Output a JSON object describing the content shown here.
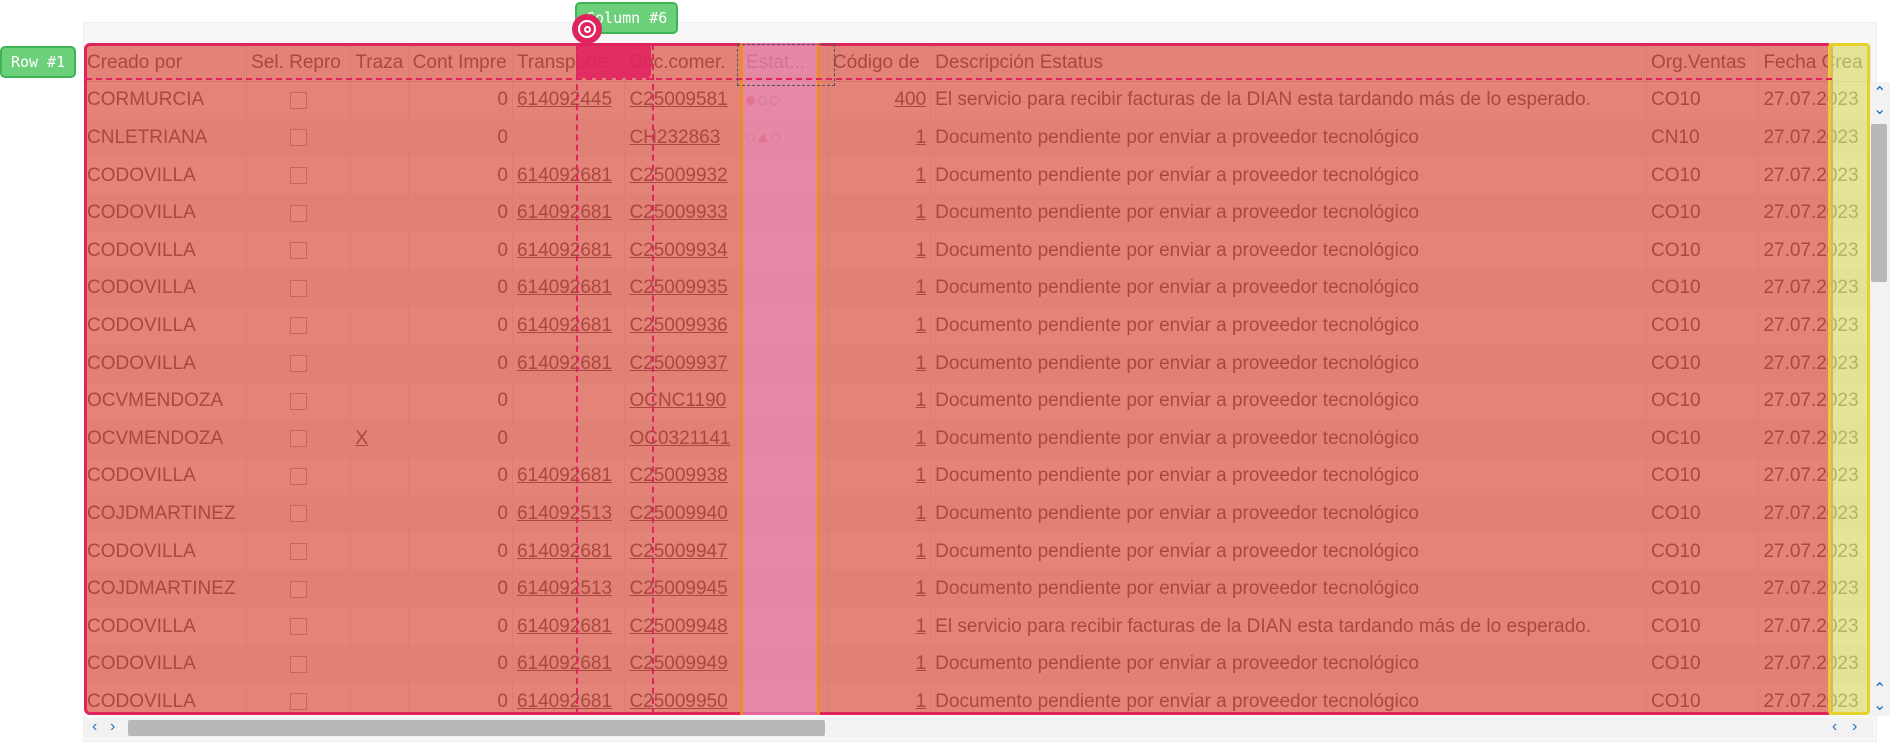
{
  "overlays": {
    "row_tag": "Row #1",
    "col_tag": "Column #6"
  },
  "columns": [
    "Creado por",
    "Sel. Repro",
    "Traza",
    "Cont Impre",
    "Transporte",
    "Doc.comer.",
    "Estat...",
    "Código de",
    "Descripción Estatus",
    "Org.Ventas",
    "Fecha Crea"
  ],
  "rows": [
    {
      "creado": "CORMURCIA",
      "traza": "",
      "cont": "0",
      "transporte": "614092445",
      "doc": "C25009581",
      "status": "red-dot",
      "codigo": "400",
      "desc": "El servicio para recibir facturas de la DIAN esta tardando más de lo esperado.",
      "org": "CO10",
      "fecha": "27.07.2023"
    },
    {
      "creado": "CNLETRIANA",
      "traza": "",
      "cont": "0",
      "transporte": "",
      "doc": "CH232863",
      "status": "triangle",
      "codigo": "1",
      "desc": "Documento pendiente por enviar a proveedor tecnológico",
      "org": "CN10",
      "fecha": "27.07.2023"
    },
    {
      "creado": "CODOVILLA",
      "traza": "",
      "cont": "0",
      "transporte": "614092681",
      "doc": "C25009932",
      "status": "",
      "codigo": "1",
      "desc": "Documento pendiente por enviar a proveedor tecnológico",
      "org": "CO10",
      "fecha": "27.07.2023"
    },
    {
      "creado": "CODOVILLA",
      "traza": "",
      "cont": "0",
      "transporte": "614092681",
      "doc": "C25009933",
      "status": "",
      "codigo": "1",
      "desc": "Documento pendiente por enviar a proveedor tecnológico",
      "org": "CO10",
      "fecha": "27.07.2023"
    },
    {
      "creado": "CODOVILLA",
      "traza": "",
      "cont": "0",
      "transporte": "614092681",
      "doc": "C25009934",
      "status": "",
      "codigo": "1",
      "desc": "Documento pendiente por enviar a proveedor tecnológico",
      "org": "CO10",
      "fecha": "27.07.2023"
    },
    {
      "creado": "CODOVILLA",
      "traza": "",
      "cont": "0",
      "transporte": "614092681",
      "doc": "C25009935",
      "status": "",
      "codigo": "1",
      "desc": "Documento pendiente por enviar a proveedor tecnológico",
      "org": "CO10",
      "fecha": "27.07.2023"
    },
    {
      "creado": "CODOVILLA",
      "traza": "",
      "cont": "0",
      "transporte": "614092681",
      "doc": "C25009936",
      "status": "",
      "codigo": "1",
      "desc": "Documento pendiente por enviar a proveedor tecnológico",
      "org": "CO10",
      "fecha": "27.07.2023"
    },
    {
      "creado": "CODOVILLA",
      "traza": "",
      "cont": "0",
      "transporte": "614092681",
      "doc": "C25009937",
      "status": "",
      "codigo": "1",
      "desc": "Documento pendiente por enviar a proveedor tecnológico",
      "org": "CO10",
      "fecha": "27.07.2023"
    },
    {
      "creado": "OCVMENDOZA",
      "traza": "",
      "cont": "0",
      "transporte": "",
      "doc": "OCNC1190",
      "status": "",
      "codigo": "1",
      "desc": "Documento pendiente por enviar a proveedor tecnológico",
      "org": "OC10",
      "fecha": "27.07.2023"
    },
    {
      "creado": "OCVMENDOZA",
      "traza": "X",
      "cont": "0",
      "transporte": "",
      "doc": "OC0321141",
      "status": "",
      "codigo": "1",
      "desc": "Documento pendiente por enviar a proveedor tecnológico",
      "org": "OC10",
      "fecha": "27.07.2023"
    },
    {
      "creado": "CODOVILLA",
      "traza": "",
      "cont": "0",
      "transporte": "614092681",
      "doc": "C25009938",
      "status": "",
      "codigo": "1",
      "desc": "Documento pendiente por enviar a proveedor tecnológico",
      "org": "CO10",
      "fecha": "27.07.2023"
    },
    {
      "creado": "COJDMARTINEZ",
      "traza": "",
      "cont": "0",
      "transporte": "614092513",
      "doc": "C25009940",
      "status": "",
      "codigo": "1",
      "desc": "Documento pendiente por enviar a proveedor tecnológico",
      "org": "CO10",
      "fecha": "27.07.2023"
    },
    {
      "creado": "CODOVILLA",
      "traza": "",
      "cont": "0",
      "transporte": "614092681",
      "doc": "C25009947",
      "status": "",
      "codigo": "1",
      "desc": "Documento pendiente por enviar a proveedor tecnológico",
      "org": "CO10",
      "fecha": "27.07.2023"
    },
    {
      "creado": "COJDMARTINEZ",
      "traza": "",
      "cont": "0",
      "transporte": "614092513",
      "doc": "C25009945",
      "status": "",
      "codigo": "1",
      "desc": "Documento pendiente por enviar a proveedor tecnológico",
      "org": "CO10",
      "fecha": "27.07.2023"
    },
    {
      "creado": "CODOVILLA",
      "traza": "",
      "cont": "0",
      "transporte": "614092681",
      "doc": "C25009948",
      "status": "",
      "codigo": "1",
      "desc": "El servicio para recibir facturas de la DIAN esta tardando más de lo esperado.",
      "org": "CO10",
      "fecha": "27.07.2023"
    },
    {
      "creado": "CODOVILLA",
      "traza": "",
      "cont": "0",
      "transporte": "614092681",
      "doc": "C25009949",
      "status": "",
      "codigo": "1",
      "desc": "Documento pendiente por enviar a proveedor tecnológico",
      "org": "CO10",
      "fecha": "27.07.2023"
    },
    {
      "creado": "CODOVILLA",
      "traza": "",
      "cont": "0",
      "transporte": "614092681",
      "doc": "C25009950",
      "status": "",
      "codigo": "1",
      "desc": "Documento pendiente por enviar a proveedor tecnológico",
      "org": "CO10",
      "fecha": "27.07.2023"
    }
  ],
  "colors": {
    "row_overlay": "#e0245e",
    "column_tag": "#6cd07a",
    "status_ring": "#6a5acd",
    "status_alert": "#e53935"
  },
  "icons": {
    "scroll_up": "chevron-up-icon",
    "scroll_down": "chevron-down-icon",
    "scroll_left": "chevron-left-icon",
    "scroll_right": "chevron-right-icon",
    "target": "target-icon"
  }
}
